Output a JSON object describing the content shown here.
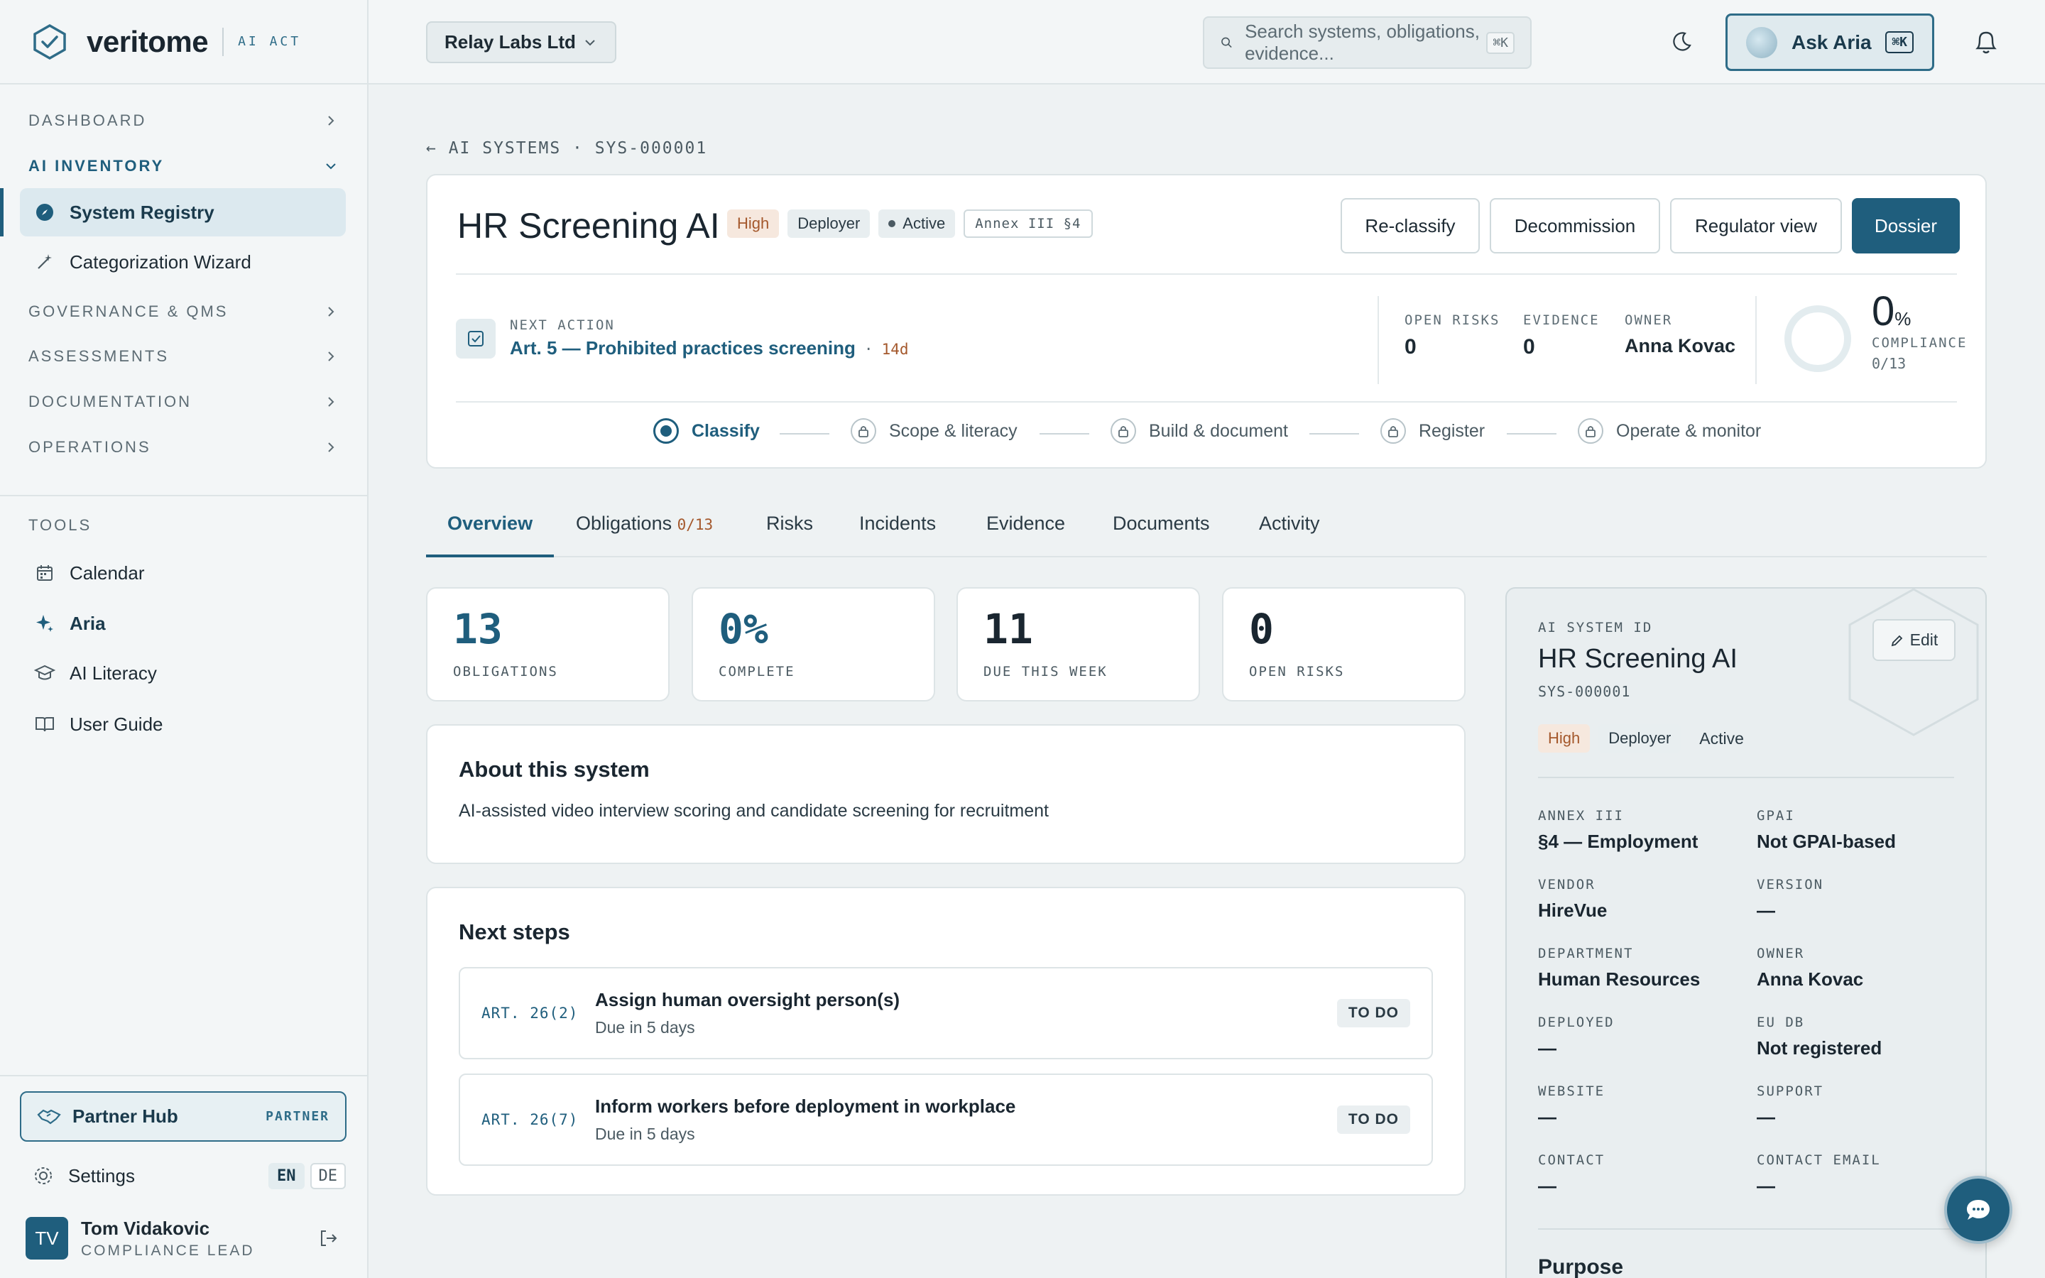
{
  "brand": {
    "name": "veritome",
    "tag": "AI ACT"
  },
  "sidebar": {
    "sections": [
      {
        "label": "DASHBOARD"
      },
      {
        "label": "AI INVENTORY"
      },
      {
        "label": "GOVERNANCE & QMS"
      },
      {
        "label": "ASSESSMENTS"
      },
      {
        "label": "DOCUMENTATION"
      },
      {
        "label": "OPERATIONS"
      }
    ],
    "inventory_items": [
      {
        "label": "System Registry",
        "icon": "compass-icon"
      },
      {
        "label": "Categorization Wizard",
        "icon": "wand-icon"
      }
    ],
    "tools_label": "TOOLS",
    "tools": [
      {
        "label": "Calendar",
        "icon": "calendar-icon"
      },
      {
        "label": "Aria",
        "icon": "sparkle-icon"
      },
      {
        "label": "AI Literacy",
        "icon": "graduation-cap-icon"
      },
      {
        "label": "User Guide",
        "icon": "book-icon"
      }
    ],
    "partner": {
      "label": "Partner Hub",
      "badge": "PARTNER"
    },
    "settings": {
      "label": "Settings",
      "lang_en": "EN",
      "lang_de": "DE"
    },
    "user": {
      "initials": "TV",
      "name": "Tom Vidakovic",
      "role": "COMPLIANCE LEAD"
    }
  },
  "topbar": {
    "org": "Relay Labs Ltd",
    "search_placeholder": "Search systems, obligations, evidence...",
    "search_kbd": "⌘K",
    "ask_label": "Ask Aria",
    "ask_kbd": "⌘K"
  },
  "breadcrumb": "← AI SYSTEMS · SYS-000001",
  "system": {
    "title": "HR Screening AI",
    "risk": "High",
    "role": "Deployer",
    "status": "Active",
    "annex": "Annex III §4",
    "buttons": {
      "reclassify": "Re-classify",
      "decommission": "Decommission",
      "regulator": "Regulator view",
      "dossier": "Dossier"
    },
    "next_action": {
      "label": "NEXT ACTION",
      "text": "Art. 5 — Prohibited practices screening",
      "due": "14d"
    },
    "stats": {
      "open_risks_label": "OPEN RISKS",
      "open_risks": "0",
      "evidence_label": "EVIDENCE",
      "evidence": "0",
      "owner_label": "OWNER",
      "owner": "Anna Kovac"
    },
    "compliance": {
      "value": "0",
      "unit": "%",
      "label": "COMPLIANCE",
      "count": "0/13",
      "fraction": 0
    },
    "steps": [
      "Classify",
      "Scope & literacy",
      "Build & document",
      "Register",
      "Operate & monitor"
    ]
  },
  "tabs": [
    {
      "label": "Overview"
    },
    {
      "label": "Obligations",
      "count": "0/13"
    },
    {
      "label": "Risks"
    },
    {
      "label": "Incidents"
    },
    {
      "label": "Evidence"
    },
    {
      "label": "Documents"
    },
    {
      "label": "Activity"
    }
  ],
  "kpis": [
    {
      "value": "13",
      "label": "OBLIGATIONS"
    },
    {
      "value": "0%",
      "label": "COMPLETE"
    },
    {
      "value": "11",
      "label": "DUE THIS WEEK"
    },
    {
      "value": "0",
      "label": "OPEN RISKS"
    }
  ],
  "about": {
    "title": "About this system",
    "text": "AI-assisted video interview scoring and candidate screening for recruitment"
  },
  "next_steps": {
    "title": "Next steps",
    "items": [
      {
        "art": "ART. 26(2)",
        "title": "Assign human oversight person(s)",
        "due": "Due in 5 days",
        "status": "TO DO"
      },
      {
        "art": "ART. 26(7)",
        "title": "Inform workers before deployment in workplace",
        "due": "Due in 5 days",
        "status": "TO DO"
      }
    ]
  },
  "panel": {
    "label": "AI SYSTEM ID",
    "name": "HR Screening AI",
    "id": "SYS-000001",
    "edit": "Edit",
    "risk": "High",
    "role": "Deployer",
    "status": "Active",
    "fields": [
      {
        "k": "ANNEX III",
        "v": "§4 — Employment"
      },
      {
        "k": "GPAI",
        "v": "Not GPAI-based"
      },
      {
        "k": "VENDOR",
        "v": "HireVue"
      },
      {
        "k": "VERSION",
        "v": "—"
      },
      {
        "k": "DEPARTMENT",
        "v": "Human Resources"
      },
      {
        "k": "OWNER",
        "v": "Anna Kovac"
      },
      {
        "k": "DEPLOYED",
        "v": "—"
      },
      {
        "k": "EU DB",
        "v": "Not registered"
      },
      {
        "k": "WEBSITE",
        "v": "—"
      },
      {
        "k": "SUPPORT",
        "v": "—"
      },
      {
        "k": "CONTACT",
        "v": "—"
      },
      {
        "k": "CONTACT EMAIL",
        "v": "—"
      }
    ],
    "purpose": "Purpose"
  },
  "colors": {
    "accent": "#1f5e7d",
    "risk_high": "#a4582c",
    "background": "#eef2f3"
  }
}
